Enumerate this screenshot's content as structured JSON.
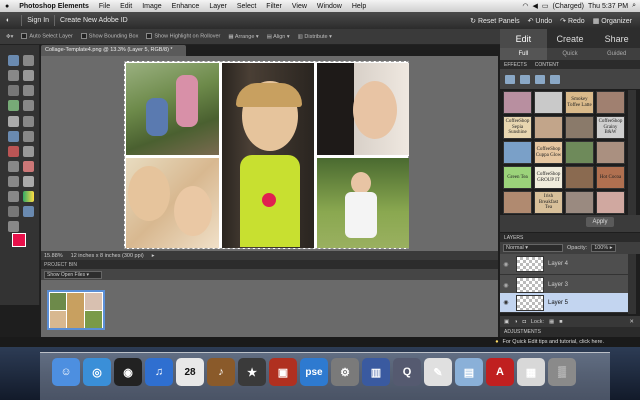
{
  "mac_menubar": {
    "apple": "",
    "app_name": "Photoshop Elements",
    "menus": [
      "File",
      "Edit",
      "Image",
      "Enhance",
      "Layer",
      "Select",
      "Filter",
      "View",
      "Window",
      "Help"
    ],
    "battery": "(Charged)",
    "clock": "Thu 5:37 PM"
  },
  "app_header": {
    "sign_in": "Sign In",
    "create_id": "Create New Adobe ID",
    "reset_panels": "Reset Panels",
    "undo": "Undo",
    "redo": "Redo",
    "organizer": "Organizer"
  },
  "options_bar": {
    "auto_select": "Auto Select Layer",
    "show_bounding": "Show Bounding Box",
    "show_highlight": "Show Highlight on Rollover",
    "arrange": "Arrange",
    "align": "Align",
    "distribute": "Distribute"
  },
  "mode_tabs": [
    "Edit",
    "Create",
    "Share"
  ],
  "edit_subtabs": [
    "Full",
    "Quick",
    "Guided"
  ],
  "document": {
    "tab_title": "Collage-Template4.png @ 13.3% (Layer 5, RGB/8) *",
    "zoom": "15.88%",
    "doc_info": "12 inches x 8 inches (300 ppi)"
  },
  "project_bin": {
    "title": "PROJECT BIN",
    "select_value": "Show Open Files"
  },
  "effects_panel": {
    "tabs": [
      "EFFECTS",
      "CONTENT"
    ],
    "tiles": [
      {
        "label": "",
        "bg": "#b88fa0"
      },
      {
        "label": "",
        "bg": "#c9c9c9"
      },
      {
        "label": "Smokey Toffee Latte",
        "bg": "#d9b98a"
      },
      {
        "label": "",
        "bg": "#a08070"
      },
      {
        "label": "CoffeeShop Sepia Sunshine",
        "bg": "#e8d6b0"
      },
      {
        "label": "",
        "bg": "#c2a58a"
      },
      {
        "label": "",
        "bg": "#8a7a6a"
      },
      {
        "label": "CoffeeShop Grainy B&W",
        "bg": "#cfcfcf"
      },
      {
        "label": "",
        "bg": "#7aa0c8"
      },
      {
        "label": "CoffeeShop Cuppa Glow",
        "bg": "#e6c6a0"
      },
      {
        "label": "",
        "bg": "#6e8a5a"
      },
      {
        "label": "",
        "bg": "#aa9080"
      },
      {
        "label": "Green Tea",
        "bg": "#9bd37a"
      },
      {
        "label": "CoffeeShop GROUP IT",
        "bg": "#f0ecdc"
      },
      {
        "label": "",
        "bg": "#8a6a50"
      },
      {
        "label": "Hot Cocoa",
        "bg": "#b07050"
      },
      {
        "label": "",
        "bg": "#b08a70"
      },
      {
        "label": "Irish Breakfast Tea",
        "bg": "#d8c09a"
      },
      {
        "label": "",
        "bg": "#9a8a80"
      },
      {
        "label": "",
        "bg": "#d0a8a0"
      }
    ],
    "apply": "Apply"
  },
  "layers_panel": {
    "title": "LAYERS",
    "blend_mode": "Normal",
    "opacity_label": "Opacity:",
    "opacity_value": "100%",
    "layers": [
      {
        "name": "Layer 4",
        "selected": false
      },
      {
        "name": "Layer 3",
        "selected": false
      },
      {
        "name": "Layer 5",
        "selected": true
      }
    ],
    "lock_label": "Lock:"
  },
  "adjustments": {
    "title": "ADJUSTMENTS"
  },
  "tip_bar": {
    "text": "For Quick Edit tips and tutorial, click here."
  },
  "dock": {
    "items": [
      {
        "name": "finder",
        "bg": "#4d8fe0",
        "glyph": "☺"
      },
      {
        "name": "safari",
        "bg": "#3a8fd8",
        "glyph": "◎"
      },
      {
        "name": "dashboard",
        "bg": "#222222",
        "glyph": "◉"
      },
      {
        "name": "itunes",
        "bg": "#2f6fd0",
        "glyph": "♫"
      },
      {
        "name": "ical",
        "bg": "#e8e8e8",
        "glyph": ""
      },
      {
        "name": "garageband",
        "bg": "#8a5a2a",
        "glyph": "♪"
      },
      {
        "name": "aperture",
        "bg": "#3a3a3a",
        "glyph": "★"
      },
      {
        "name": "photobooth",
        "bg": "#b03020",
        "glyph": "▣"
      },
      {
        "name": "photoshop-elements",
        "bg": "#2e7ad0",
        "glyph": "pse"
      },
      {
        "name": "system-preferences",
        "bg": "#7a7a7a",
        "glyph": "⚙"
      },
      {
        "name": "activity-monitor",
        "bg": "#3a5aa0",
        "glyph": "▥"
      },
      {
        "name": "quicktime",
        "bg": "#555a70",
        "glyph": "Q"
      },
      {
        "name": "textedit",
        "bg": "#e0e0e0",
        "glyph": "✎"
      },
      {
        "name": "preview",
        "bg": "#8ab0d8",
        "glyph": "▤"
      },
      {
        "name": "acrobat",
        "bg": "#c02020",
        "glyph": "A"
      },
      {
        "name": "documents",
        "bg": "#d8d8d8",
        "glyph": "▦"
      },
      {
        "name": "trash",
        "bg": "#8a8a8a",
        "glyph": "▒"
      }
    ],
    "calendar_day": "28"
  }
}
